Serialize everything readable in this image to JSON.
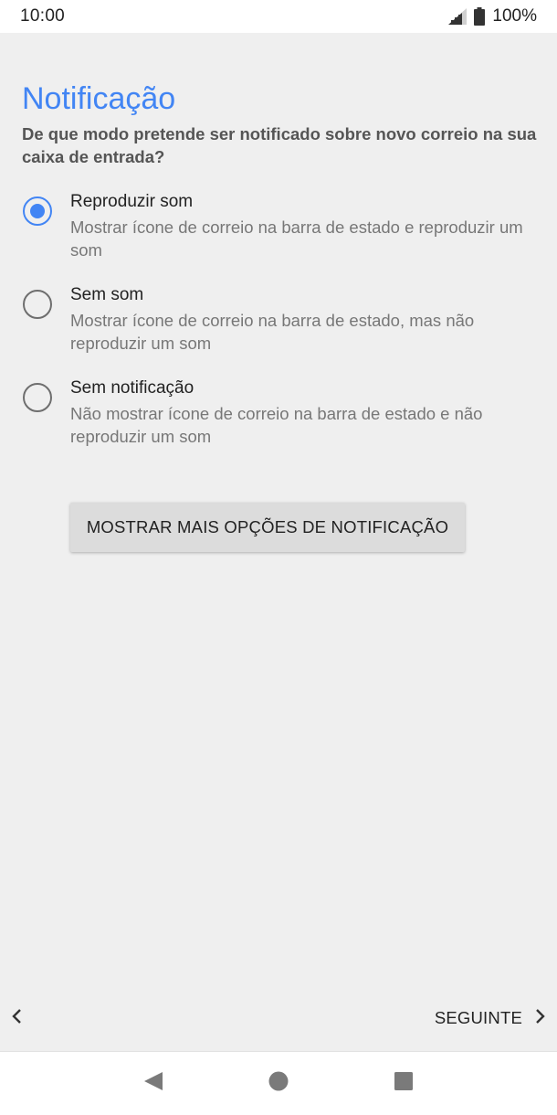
{
  "status_bar": {
    "time": "10:00",
    "battery": "100%"
  },
  "header": {
    "title": "Notificação",
    "subtitle": "De que modo pretende ser notificado sobre novo correio na sua caixa de entrada?"
  },
  "options": [
    {
      "title": "Reproduzir som",
      "description": "Mostrar ícone de correio na barra de estado e reproduzir um som",
      "selected": true
    },
    {
      "title": "Sem som",
      "description": "Mostrar ícone de correio na barra de estado, mas não reproduzir um som",
      "selected": false
    },
    {
      "title": "Sem notificação",
      "description": "Não mostrar ícone de correio na barra de estado e não reproduzir um som",
      "selected": false
    }
  ],
  "more_options_button": "MOSTRAR MAIS OPÇÕES DE NOTIFICAÇÃO",
  "footer": {
    "next_label": "SEGUINTE"
  },
  "colors": {
    "accent": "#4285f4",
    "background": "#efefef"
  }
}
